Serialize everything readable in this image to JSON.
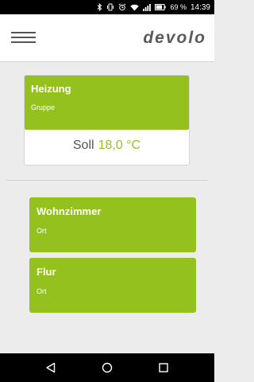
{
  "status_bar": {
    "battery_percent": "69 %",
    "time": "14:39",
    "icons": [
      "bluetooth-icon",
      "vibrate-icon",
      "alarm-icon",
      "wifi-icon",
      "signal-icon",
      "battery-icon"
    ]
  },
  "header": {
    "logo": "devolo",
    "menu_icon": "hamburger-menu-icon"
  },
  "group_card": {
    "title": "Heizung",
    "subtitle": "Gruppe",
    "setpoint_label": "Soll",
    "setpoint_value": "18,0 °C"
  },
  "rooms": [
    {
      "title": "Wohnzimmer",
      "subtitle": "Ort"
    },
    {
      "title": "Flur",
      "subtitle": "Ort"
    }
  ],
  "nav_bar": {
    "icons": [
      "back-icon",
      "home-icon",
      "recents-icon"
    ]
  },
  "colors": {
    "accent": "#95c11f",
    "background": "#ececec",
    "header": "#ffffff",
    "system_bars": "#000000"
  }
}
